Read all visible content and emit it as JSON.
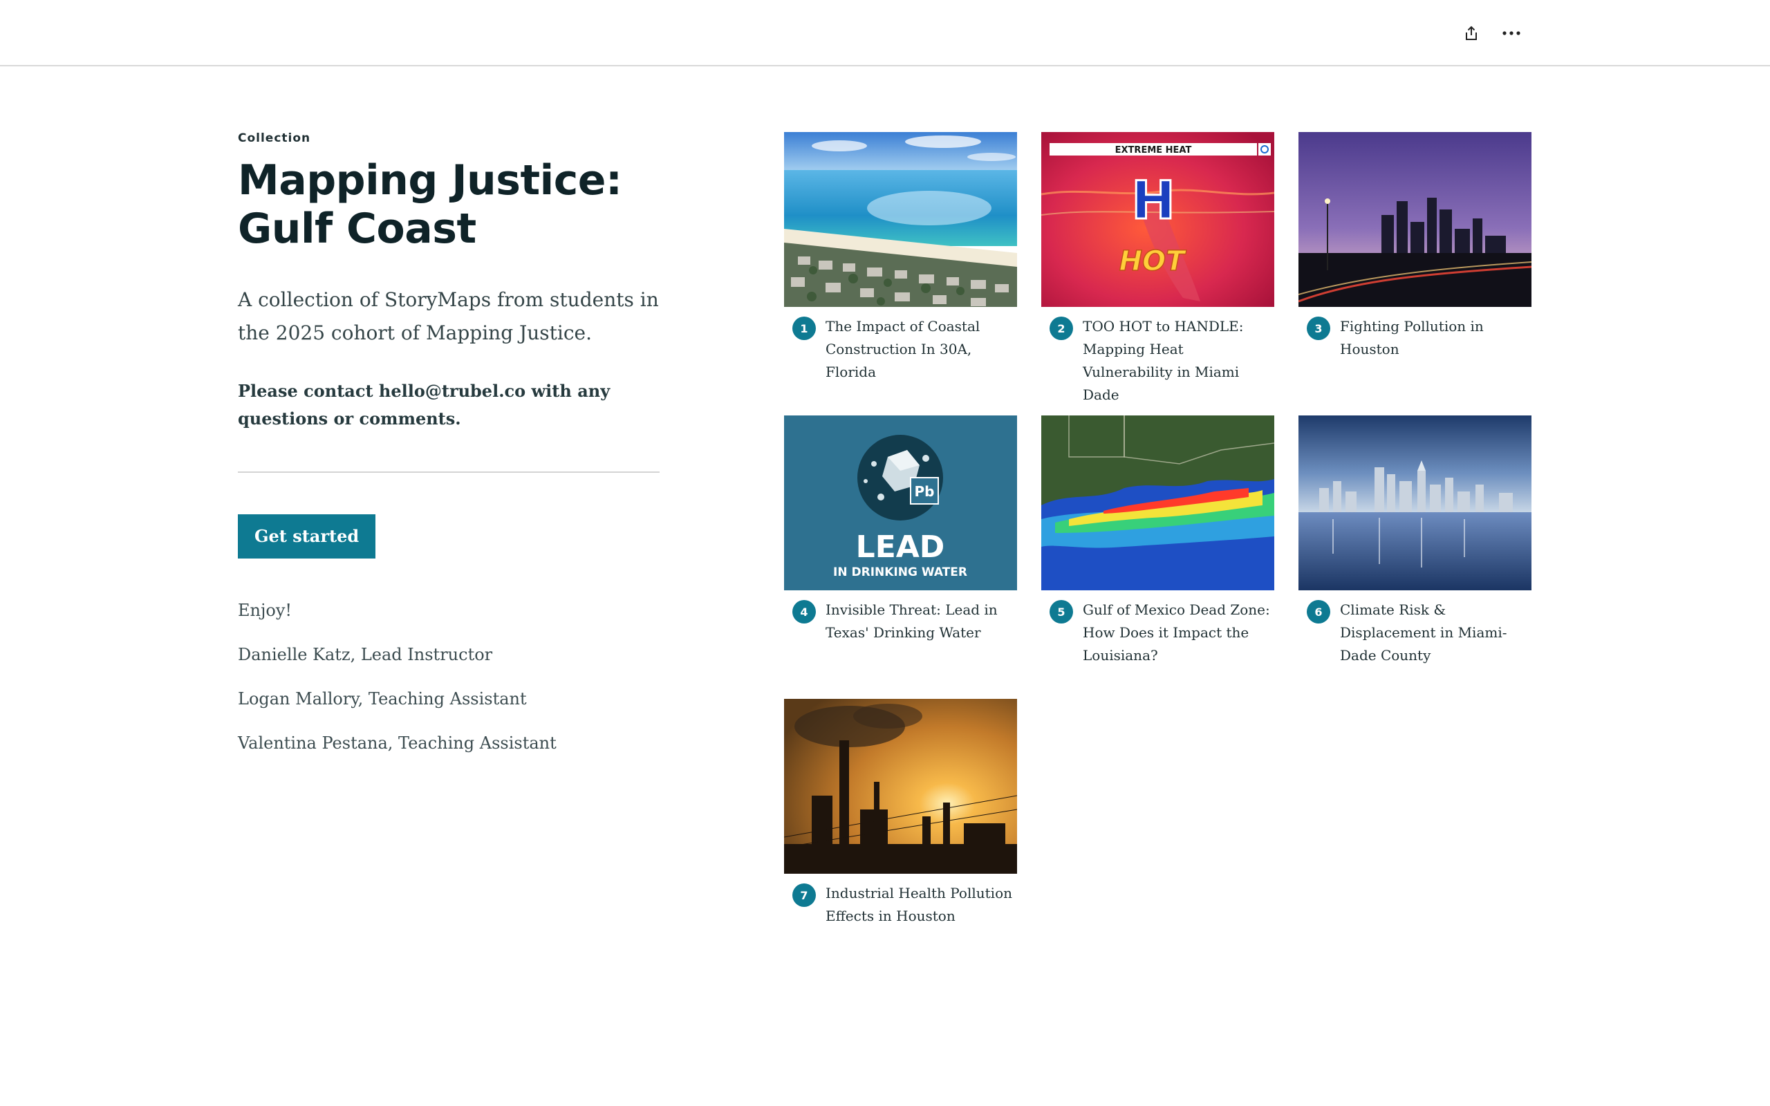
{
  "header": {
    "share_icon": "share-icon",
    "more_icon": "more-horizontal-icon"
  },
  "intro": {
    "kicker": "Collection",
    "title": "Mapping Justice: Gulf Coast",
    "description": "A collection of StoryMaps from students in the 2025 cohort of Mapping Justice.",
    "contact": "Please contact hello@trubel.co with any questions or comments.",
    "button_label": "Get started",
    "notes": [
      "Enjoy!",
      "Danielle Katz, Lead Instructor",
      "Logan Mallory, Teaching Assistant",
      "Valentina Pestana, Teaching Assistant"
    ]
  },
  "accent_color": "#0e7a92",
  "items": [
    {
      "number": "1",
      "title": "The Impact of Coastal Construction In 30A, Florida"
    },
    {
      "number": "2",
      "title": "TOO HOT to HANDLE: Mapping Heat Vulnerability in Miami Dade",
      "image_text": {
        "banner": "EXTREME HEAT",
        "letter": "H",
        "word": "HOT"
      }
    },
    {
      "number": "3",
      "title": "Fighting Pollution in Houston"
    },
    {
      "number": "4",
      "title": "Invisible Threat: Lead in Texas' Drinking Water",
      "image_text": {
        "big": "LEAD",
        "small": "IN DRINKING WATER",
        "element": "Pb"
      }
    },
    {
      "number": "5",
      "title": "Gulf of Mexico Dead Zone: How Does it Impact the Louisiana?"
    },
    {
      "number": "6",
      "title": "Climate Risk & Displacement in Miami-Dade County"
    },
    {
      "number": "7",
      "title": "Industrial Health Pollution Effects in Houston"
    }
  ]
}
